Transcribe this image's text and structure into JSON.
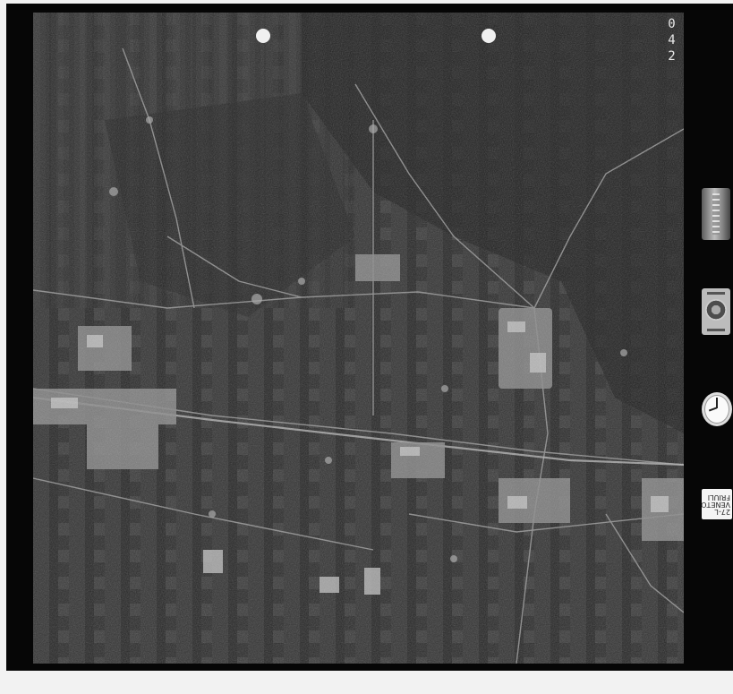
{
  "frame": {
    "number_digits": [
      "0",
      "4",
      "2"
    ],
    "region_label_lines": [
      "27-L",
      "VENETO",
      "FRIULI"
    ]
  },
  "colors": {
    "film_border": "#060606",
    "background": "#f2f2f2",
    "photo_base": "#2a2a2a"
  },
  "instruments": {
    "altimeter": "altimeter-gauge",
    "level": "bubble-level",
    "clock": "clock-dial"
  }
}
